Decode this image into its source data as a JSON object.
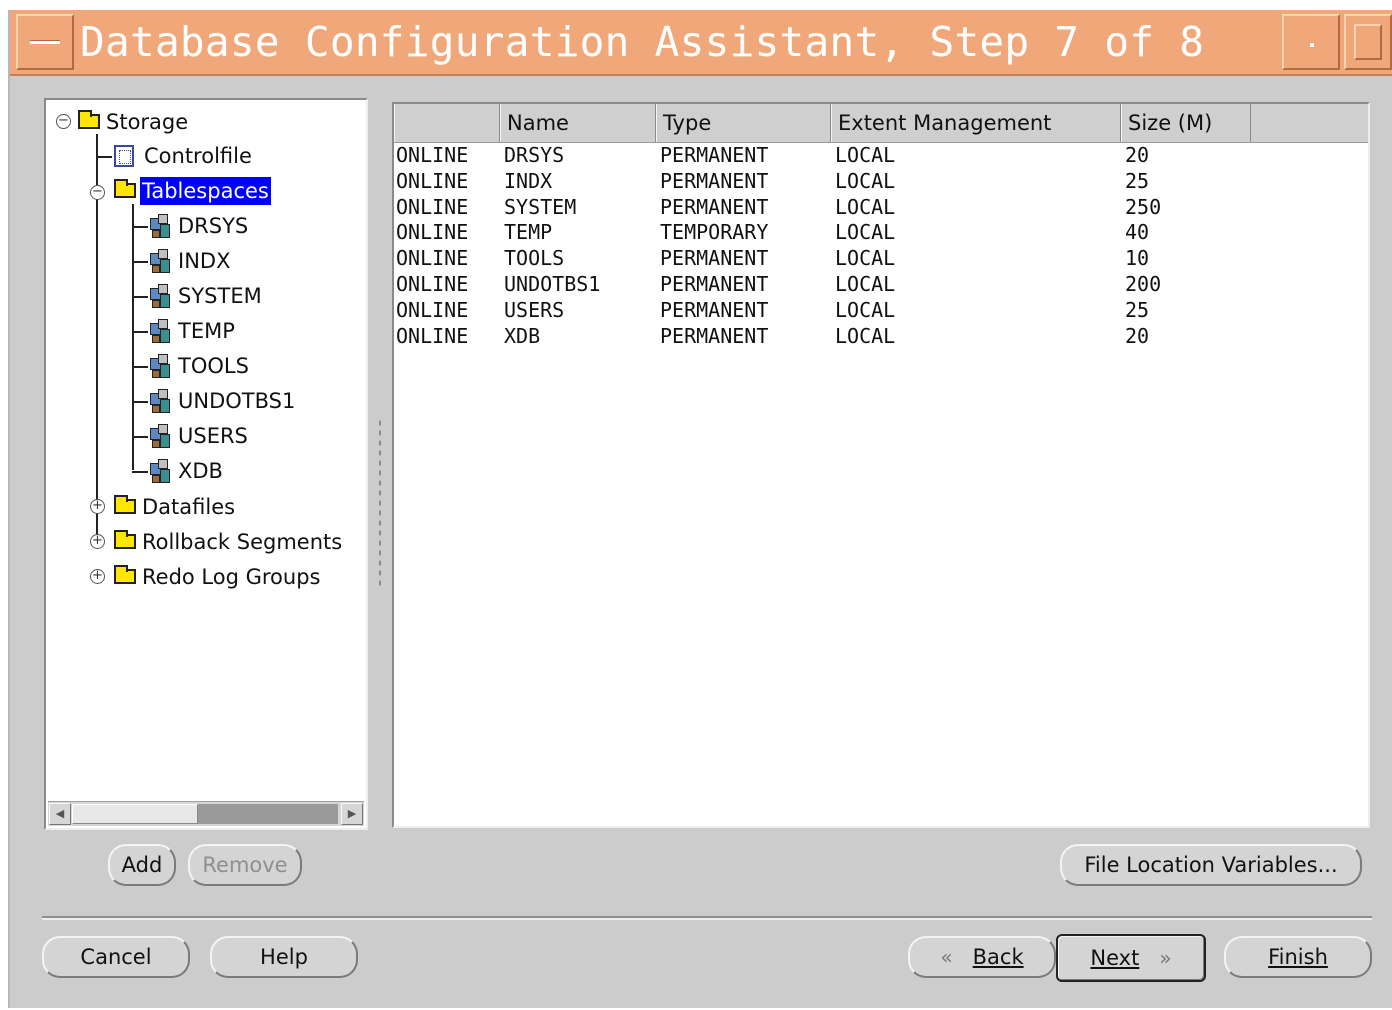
{
  "window": {
    "title": "Database Configuration Assistant, Step 7 of 8"
  },
  "tree": {
    "root": "Storage",
    "controlfile": "Controlfile",
    "tablespaces": "Tablespaces",
    "tablespace_items": [
      "DRSYS",
      "INDX",
      "SYSTEM",
      "TEMP",
      "TOOLS",
      "UNDOTBS1",
      "USERS",
      "XDB"
    ],
    "datafiles": "Datafiles",
    "rollback_segments": "Rollback Segments",
    "redo_log_groups": "Redo Log Groups",
    "selected": "Tablespaces"
  },
  "table": {
    "columns": [
      "",
      "Name",
      "Type",
      "Extent Management",
      "Size (M)"
    ],
    "rows": [
      [
        "ONLINE",
        "DRSYS",
        "PERMANENT",
        "LOCAL",
        "20"
      ],
      [
        "ONLINE",
        "INDX",
        "PERMANENT",
        "LOCAL",
        "25"
      ],
      [
        "ONLINE",
        "SYSTEM",
        "PERMANENT",
        "LOCAL",
        "250"
      ],
      [
        "ONLINE",
        "TEMP",
        "TEMPORARY",
        "LOCAL",
        "40"
      ],
      [
        "ONLINE",
        "TOOLS",
        "PERMANENT",
        "LOCAL",
        "10"
      ],
      [
        "ONLINE",
        "UNDOTBS1",
        "PERMANENT",
        "LOCAL",
        "200"
      ],
      [
        "ONLINE",
        "USERS",
        "PERMANENT",
        "LOCAL",
        "25"
      ],
      [
        "ONLINE",
        "XDB",
        "PERMANENT",
        "LOCAL",
        "20"
      ]
    ]
  },
  "buttons": {
    "add": "Add",
    "remove": "Remove",
    "file_location_variables": "File Location Variables...",
    "cancel": "Cancel",
    "help": "Help",
    "back": "Back",
    "next": "Next",
    "finish": "Finish"
  },
  "colors": {
    "titlebar": "#f0a77a",
    "selection": "#0000ff",
    "folder": "#ffe600"
  }
}
